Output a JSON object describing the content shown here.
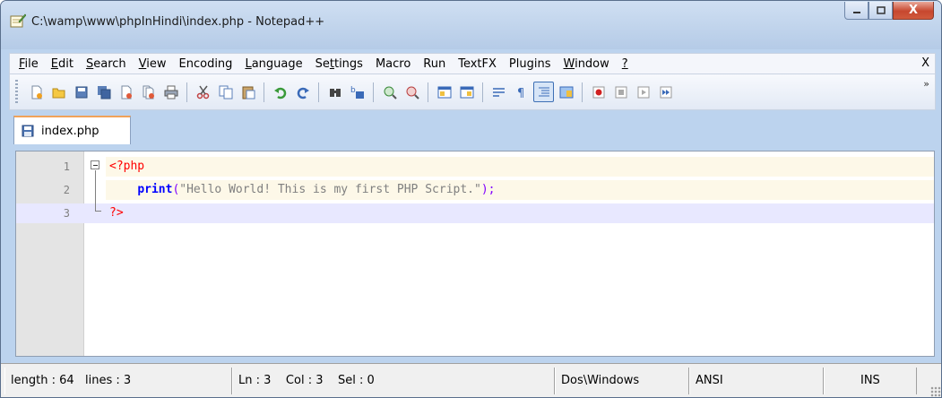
{
  "window": {
    "title": "C:\\wamp\\www\\phpInHindi\\index.php - Notepad++",
    "controls": {
      "minimize": "—",
      "maximize": "▢",
      "close": "X"
    }
  },
  "menubar": {
    "items": [
      {
        "label": "File",
        "underline": "F"
      },
      {
        "label": "Edit",
        "underline": "E"
      },
      {
        "label": "Search",
        "underline": "S"
      },
      {
        "label": "View",
        "underline": "V"
      },
      {
        "label": "Encoding"
      },
      {
        "label": "Language",
        "underline": "L"
      },
      {
        "label": "Settings",
        "underline": "t"
      },
      {
        "label": "Macro"
      },
      {
        "label": "Run"
      },
      {
        "label": "TextFX"
      },
      {
        "label": "Plugins"
      },
      {
        "label": "Window",
        "underline": "W"
      },
      {
        "label": "?"
      }
    ],
    "close_label": "X"
  },
  "toolbar": {
    "icons": [
      "new-file-icon",
      "open-file-icon",
      "save-icon",
      "save-all-icon",
      "close-icon",
      "close-all-icon",
      "print-icon",
      "cut-icon",
      "copy-icon",
      "paste-icon",
      "undo-icon",
      "redo-icon",
      "find-icon",
      "replace-icon",
      "zoom-in-icon",
      "zoom-out-icon",
      "sync-vertical-icon",
      "sync-horizontal-icon",
      "word-wrap-icon",
      "show-all-chars-icon",
      "indent-guide-icon",
      "document-map-icon",
      "record-macro-icon",
      "stop-macro-icon",
      "play-macro-icon",
      "run-macro-multiple-icon"
    ],
    "more": "»"
  },
  "tabs": [
    {
      "label": "index.php",
      "icon": "saved-file-icon",
      "active": true
    }
  ],
  "editor": {
    "lines": [
      {
        "number": "1",
        "tag_open": "<?php"
      },
      {
        "number": "2",
        "indent": "    ",
        "keyword": "print",
        "paren_open": "(",
        "string": "\"Hello World! This is my first PHP Script.\"",
        "paren_close": ")",
        "semicolon": ";"
      },
      {
        "number": "3",
        "tag_close": "?>"
      }
    ],
    "current_line": 3,
    "colors": {
      "tag": "#ff0000",
      "keyword": "#0000ff",
      "string": "#808080",
      "operator": "#8000ff",
      "current_line_bg": "#e8e8ff"
    }
  },
  "statusbar": {
    "length": "length : 64",
    "lines": "lines : 3",
    "position": "Ln : 3    Col : 3    Sel : 0",
    "eol": "Dos\\Windows",
    "encoding": "ANSI",
    "mode": "INS"
  }
}
